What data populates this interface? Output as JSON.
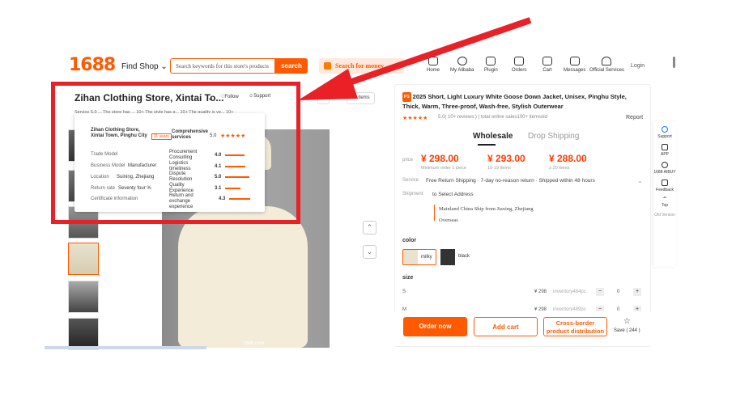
{
  "header": {
    "logo": "1688",
    "find_shop": "Find Shop",
    "search_placeholder": "Search keywords for this store's products",
    "search_btn": "search",
    "search_money": "Search for money",
    "nav": [
      {
        "label": "Home"
      },
      {
        "label": "My Alibaba"
      },
      {
        "label": "Plugin"
      },
      {
        "label": "Orders"
      },
      {
        "label": "Cart"
      },
      {
        "label": "Messages"
      },
      {
        "label": "Official Services"
      }
    ],
    "login": "Login"
  },
  "store": {
    "name": "Zihan Clothing Store, Xintai To...",
    "follow": "Follow",
    "support": "Support",
    "tags": [
      "e",
      "All items"
    ],
    "reviews_line": "Service 5.0 ... The store has ... 10+   The style has q... 10+   The quality is ve... 10+"
  },
  "popup": {
    "store_name": "Zihan Clothing Store, Xintai Town, Pinghu City",
    "years": "11 years",
    "comprehensive_label": "Comprehensive services",
    "comprehensive_score": "5.0",
    "left": [
      {
        "label": "Trade Model",
        "value": ""
      },
      {
        "label": "Business Model",
        "value": "Manufacturer"
      },
      {
        "label": "Location",
        "value": "Suining, Zhejiang"
      },
      {
        "label": "Return rate",
        "value": "Seventy four %"
      },
      {
        "label": "Certificate information",
        "value": ""
      }
    ],
    "scores": [
      {
        "label": "Procurement Consulting",
        "value": "4.0",
        "level": 0.8
      },
      {
        "label": "Logistics timeliness",
        "value": "4.1",
        "level": 0.82
      },
      {
        "label": "Dispute Resolution",
        "value": "5.0",
        "level": 1.0
      },
      {
        "label": "Quality Experience",
        "value": "3.1",
        "level": 0.62
      },
      {
        "label": "Return and exchange experience",
        "value": "4.3",
        "level": 0.86
      }
    ]
  },
  "gallery": {
    "watermark": "1688.com"
  },
  "product": {
    "badge": "PS",
    "title": "2025 Short, Light Luxury White Goose Down Jacket, Unisex, Pinghu Style, Thick, Warm, Three-proof, Wash-free, Stylish Outerwear",
    "stars": "★★★★★",
    "rating": "5.0( 10+ reviews )  |  total online sales100+ itemsold",
    "report": "Report",
    "tab_wholesale": "Wholesale",
    "tab_drop": "Drop Shipping",
    "price_label": "price",
    "prices": [
      {
        "v": "¥ 298.00",
        "s": "Minimum order 1 piece"
      },
      {
        "v": "¥ 293.00",
        "s": "10-19 items"
      },
      {
        "v": "¥ 288.00",
        "s": "≥ 20 items"
      }
    ],
    "service_label": "Service",
    "service_text": "Free Return Shipping · 7-day no-reason return · Shipped within 48 hours",
    "shipment_label": "Shipment",
    "shipment_text": "to Select Address",
    "ship_from": "Mainland China Ship from Jiaxing, Zhejiang",
    "overseas": "Overseas",
    "color_label": "color",
    "colors": [
      {
        "label": "milky"
      },
      {
        "label": "black"
      }
    ],
    "size_label": "size",
    "sizes": [
      {
        "size": "S",
        "price": "¥ 298",
        "inv": "inventory484pc",
        "qty": "0"
      },
      {
        "size": "M",
        "price": "¥ 298",
        "inv": "inventory489pc",
        "qty": "0"
      }
    ],
    "order_btn": "Order now",
    "cart_btn": "Add cart",
    "cross_btn": "Cross-border product distribution",
    "save": "Save ( 244 )"
  },
  "sidebar": [
    {
      "label": "Support"
    },
    {
      "label": "APP"
    },
    {
      "label": "1688 AIBUY"
    },
    {
      "label": "Feedback"
    },
    {
      "label": "Top"
    },
    {
      "label": "Old Version"
    }
  ],
  "colors": {
    "brand": "#ff5a00",
    "annotation": "#ea2027"
  }
}
